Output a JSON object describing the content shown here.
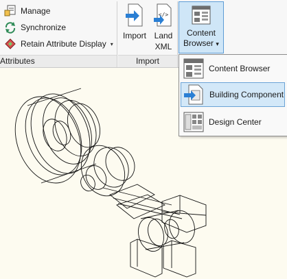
{
  "ribbon": {
    "attributes_panel": {
      "title": "Attributes",
      "commands": [
        {
          "label": "Manage",
          "icon": "manage-attributes-icon"
        },
        {
          "label": "Synchronize",
          "icon": "synchronize-icon"
        },
        {
          "label": "Retain Attribute Display",
          "icon": "retain-attribute-display-icon",
          "has_dropdown": true
        }
      ]
    },
    "import_panel": {
      "title": "Import",
      "import_label": "Import",
      "landxml_label_1": "Land",
      "landxml_label_2": "XML"
    },
    "content_browser": {
      "label_1": "Content",
      "label_2": "Browser",
      "dropdown_arrow": "▾"
    }
  },
  "dropdown_menu": {
    "items": [
      {
        "label": "Content Browser",
        "icon": "content-browser-icon",
        "selected": false
      },
      {
        "label": "Building Component",
        "icon": "building-component-icon",
        "selected": true
      },
      {
        "label": "Design Center",
        "icon": "design-center-icon",
        "selected": false
      }
    ]
  },
  "colors": {
    "canvas": "#fdfbf0",
    "highlight": "#d3e8f8",
    "highlight_border": "#6aa3d6",
    "accent_blue": "#2a7fd4"
  }
}
